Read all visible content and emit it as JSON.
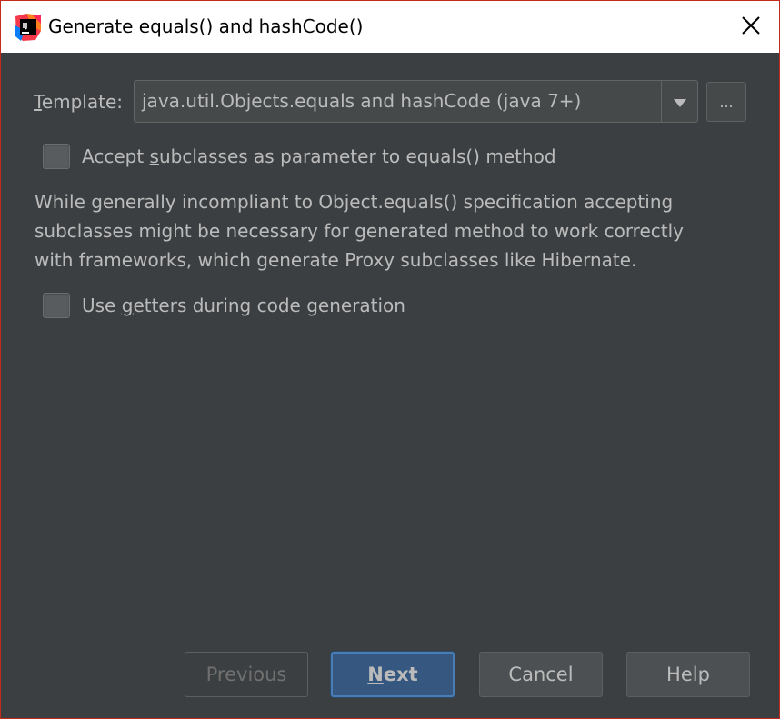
{
  "window": {
    "title": "Generate equals() and hashCode()",
    "icons": {
      "app": "intellij-idea-icon",
      "close": "close-icon"
    },
    "accent_color": "#c42b1c"
  },
  "template": {
    "label_mnemonic": "T",
    "label_rest": "emplate:",
    "selected_value": "java.util.Objects.equals and hashCode (java 7+)",
    "ellipsis_label": "..."
  },
  "options": {
    "accept_subclasses": {
      "checked": false,
      "label_pre": "Accept ",
      "label_mnemonic": "s",
      "label_post": "ubclasses as parameter to equals() method"
    },
    "use_getters": {
      "checked": false,
      "label_pre": "Use ",
      "label_mnemonic": "g",
      "label_post": "etters during code generation"
    }
  },
  "description": {
    "lines": [
      "While generally incompliant to Object.equals() specification accepting",
      "subclasses might be necessary for generated method to work correctly",
      "with frameworks, which generate Proxy subclasses like Hibernate."
    ]
  },
  "buttons": {
    "previous": "Previous",
    "next_mnemonic": "N",
    "next_rest": "ext",
    "cancel": "Cancel",
    "help": "Help"
  },
  "colors": {
    "background": "#3c3f41",
    "text": "#bbbbbb",
    "default_button": "#365880",
    "default_button_border": "#4a7cb5"
  }
}
